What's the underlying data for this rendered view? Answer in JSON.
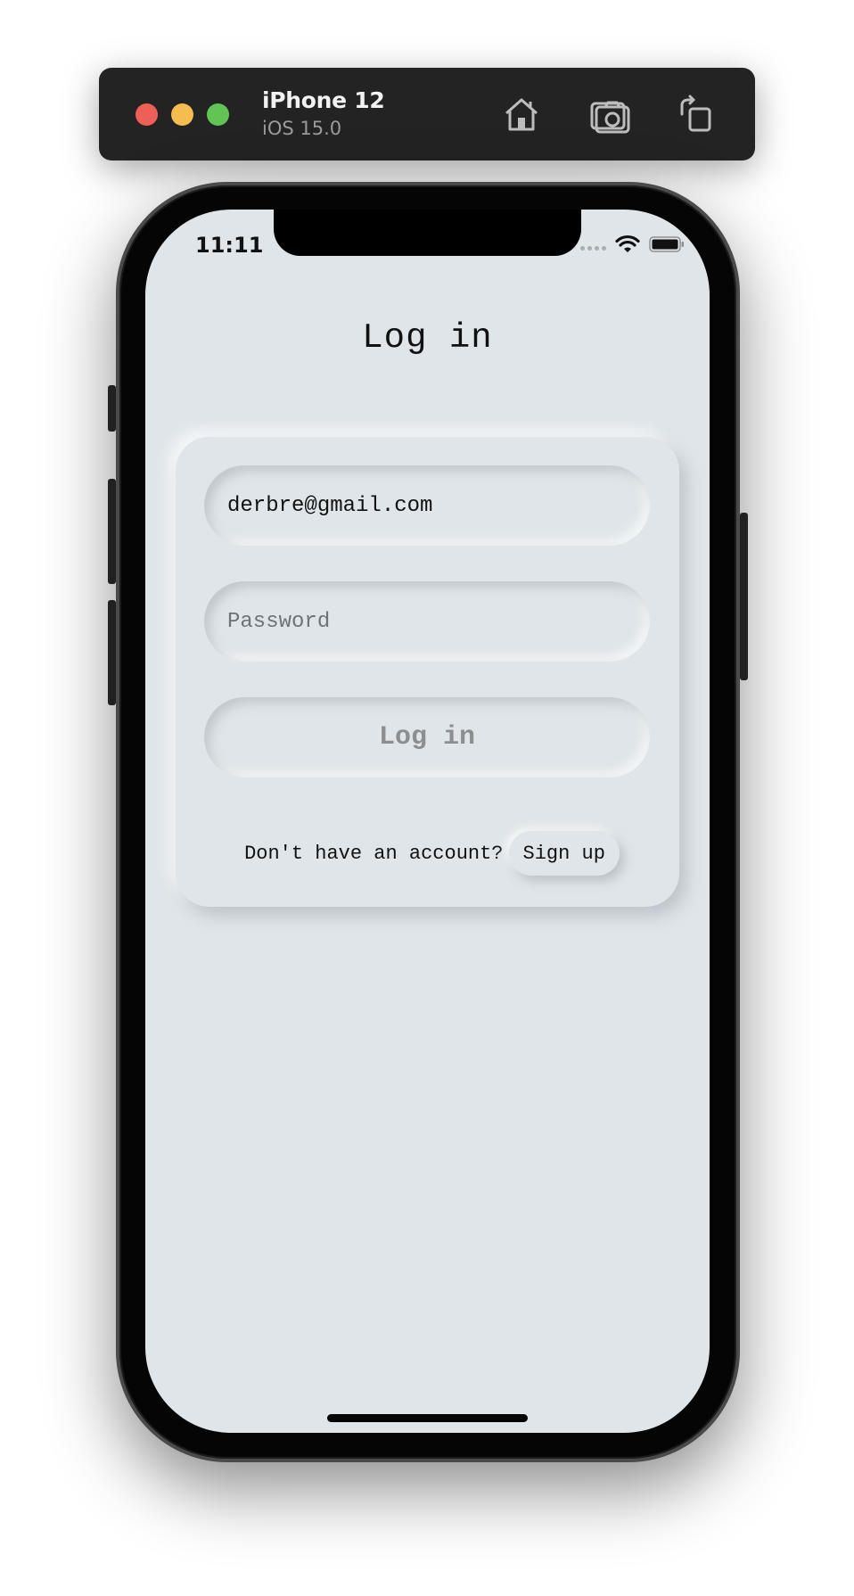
{
  "simulator": {
    "device_name": "iPhone 12",
    "os_version": "iOS 15.0",
    "traffic_colors": {
      "close": "#ee5f57",
      "minimize": "#f5bd4f",
      "zoom": "#61c454"
    },
    "toolbar_icons": [
      "home-icon",
      "screenshot-icon",
      "rotate-icon"
    ]
  },
  "status_bar": {
    "time": "11:11",
    "icons": [
      "signal-icon",
      "wifi-icon",
      "battery-icon"
    ]
  },
  "app": {
    "title": "Log in",
    "email_value": "derbre@gmail.com",
    "password_placeholder": "Password",
    "login_button_label": "Log in",
    "signup_prompt": "Don't have an account?",
    "signup_button_label": "Sign up"
  },
  "colors": {
    "screen_background": "#dfe5e8",
    "toolbar_background": "#232323",
    "disabled_text": "#8b8f92"
  }
}
